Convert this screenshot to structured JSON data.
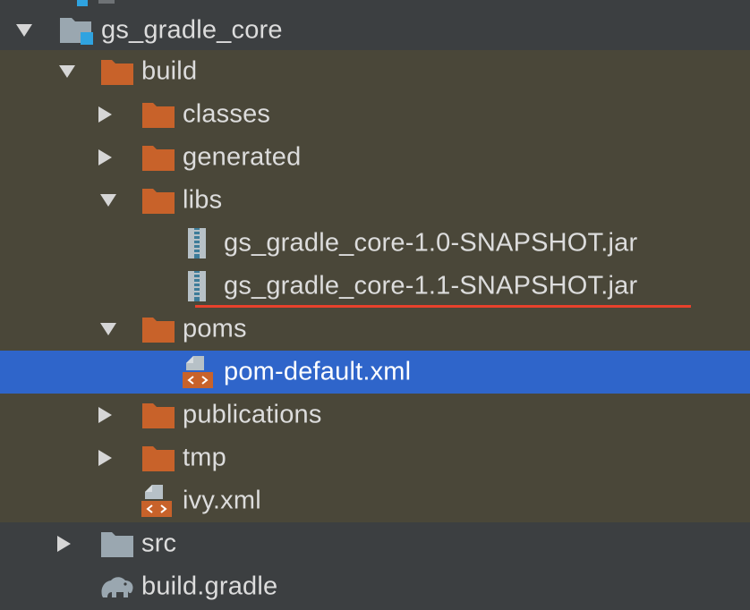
{
  "tree": {
    "root": {
      "label": "gs_gradle_core",
      "expanded": true
    },
    "build": {
      "label": "build",
      "expanded": true
    },
    "classes": {
      "label": "classes",
      "expanded": false
    },
    "generated": {
      "label": "generated",
      "expanded": false
    },
    "libs": {
      "label": "libs",
      "expanded": true
    },
    "jar10": {
      "label": "gs_gradle_core-1.0-SNAPSHOT.jar"
    },
    "jar11": {
      "label": "gs_gradle_core-1.1-SNAPSHOT.jar",
      "highlighted": true
    },
    "poms": {
      "label": "poms",
      "expanded": true
    },
    "pom_default": {
      "label": "pom-default.xml",
      "selected": true,
      "highlighted": true
    },
    "publications": {
      "label": "publications",
      "expanded": false
    },
    "tmp": {
      "label": "tmp",
      "expanded": false
    },
    "ivy": {
      "label": "ivy.xml"
    },
    "src": {
      "label": "src",
      "expanded": false
    },
    "build_gradle": {
      "label": "build.gradle"
    }
  },
  "colors": {
    "background": "#3c3f41",
    "excluded_background": "#4a4739",
    "selection": "#2f65ca",
    "folder_excluded": "#c8622a",
    "folder_normal": "#9aa7b0",
    "highlight_underline": "#e8412c"
  }
}
